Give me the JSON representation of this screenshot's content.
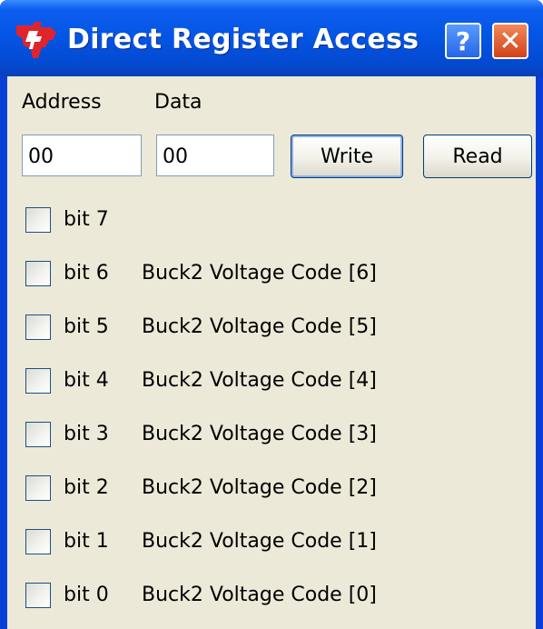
{
  "window": {
    "title": "Direct Register Access",
    "help_label": "?",
    "close_label": "✕",
    "app_icon": "ti-logo-icon"
  },
  "form": {
    "address_label": "Address",
    "data_label": "Data",
    "address_value": "00",
    "data_value": "00",
    "write_label": "Write",
    "read_label": "Read"
  },
  "bits": [
    {
      "label": "bit 7",
      "description": ""
    },
    {
      "label": "bit 6",
      "description": "Buck2 Voltage Code [6]"
    },
    {
      "label": "bit 5",
      "description": "Buck2 Voltage Code [5]"
    },
    {
      "label": "bit 4",
      "description": "Buck2 Voltage Code [4]"
    },
    {
      "label": "bit 3",
      "description": "Buck2 Voltage Code [3]"
    },
    {
      "label": "bit 2",
      "description": "Buck2 Voltage Code [2]"
    },
    {
      "label": "bit 1",
      "description": "Buck2 Voltage Code [1]"
    },
    {
      "label": "bit 0",
      "description": "Buck2 Voltage Code [0]"
    }
  ],
  "colors": {
    "titlebar": "#0454e3",
    "client_bg": "#ece9d8",
    "close_button": "#d2421a"
  }
}
